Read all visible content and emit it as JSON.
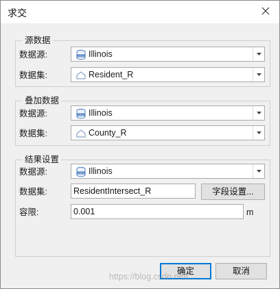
{
  "dialog": {
    "title": "求交"
  },
  "source": {
    "title": "源数据",
    "datasource_label": "数据源:",
    "datasource": "Illinois",
    "dataset_label": "数据集:",
    "dataset": "Resident_R"
  },
  "overlay": {
    "title": "叠加数据",
    "datasource_label": "数据源:",
    "datasource": "Illinois",
    "dataset_label": "数据集:",
    "dataset": "County_R"
  },
  "result": {
    "title": "结果设置",
    "datasource_label": "数据源:",
    "datasource": "Illinois",
    "dataset_label": "数据集:",
    "dataset_value": "ResidentIntersect_R",
    "field_settings_label": "字段设置...",
    "tolerance_label": "容限:",
    "tolerance_value": "0.001",
    "tolerance_unit": "m"
  },
  "footer": {
    "ok_label": "确定",
    "cancel_label": "取消",
    "watermark": "https://blog.csdn.net/..."
  },
  "icons": {
    "datasource": "database-udbx-icon",
    "dataset": "region-dataset-icon",
    "dropdown": "chevron-down-icon",
    "close": "close-icon"
  }
}
